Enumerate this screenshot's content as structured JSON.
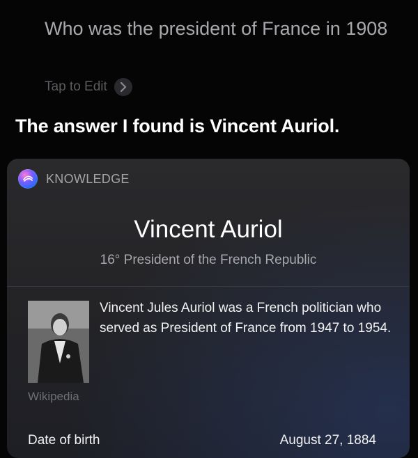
{
  "query": {
    "text": "Who was the president of France in 1908",
    "edit_label": "Tap to Edit"
  },
  "answer": "The answer I found is Vincent Auriol.",
  "card": {
    "source_label": "KNOWLEDGE",
    "title": "Vincent Auriol",
    "subtitle": "16° President of the French Republic",
    "summary": "Vincent Jules Auriol was a French politician who served as President of France from 1947 to 1954.",
    "attribution": "Wikipedia",
    "facts": [
      {
        "label": "Date of birth",
        "value": "August 27, 1884"
      }
    ]
  },
  "colors": {
    "background": "#050505",
    "card": "#2a2a2d",
    "muted_text": "#a9a9ad"
  }
}
